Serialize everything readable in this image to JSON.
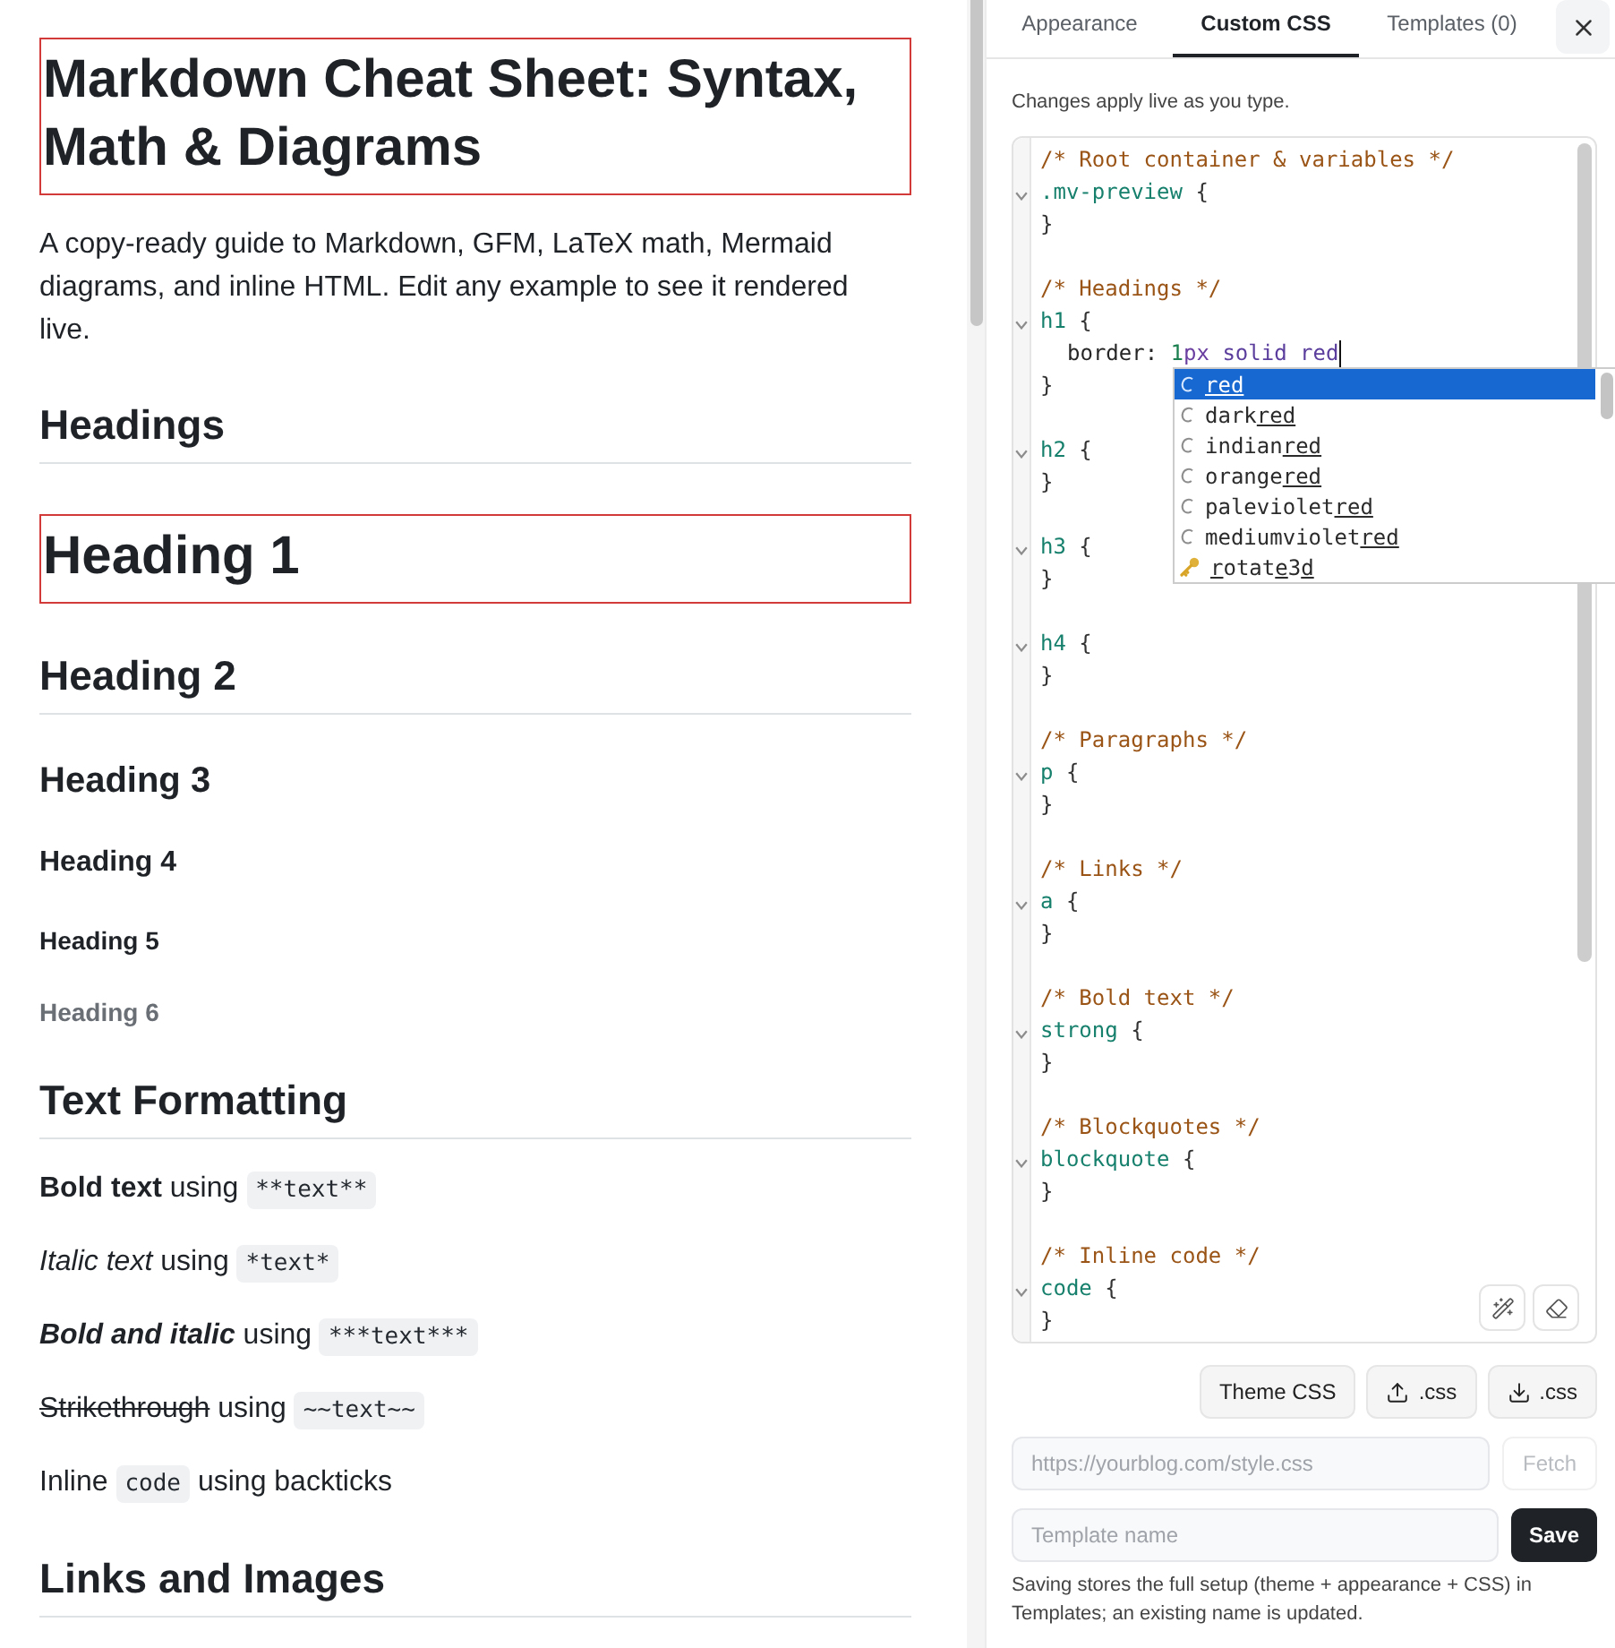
{
  "preview": {
    "blocks": [
      {
        "kind": "h1",
        "text": "Markdown Cheat Sheet: Syntax, Math & Diagrams"
      },
      {
        "kind": "p",
        "text": "A copy-ready guide to Markdown, GFM, LaTeX math, Mermaid diagrams, and inline HTML. Edit any example to see it rendered live."
      },
      {
        "kind": "h2",
        "text": "Headings"
      },
      {
        "kind": "h1",
        "text": "Heading 1"
      },
      {
        "kind": "h2",
        "text": "Heading 2"
      },
      {
        "kind": "h3",
        "text": "Heading 3"
      },
      {
        "kind": "h4",
        "text": "Heading 4"
      },
      {
        "kind": "h5",
        "text": "Heading 5"
      },
      {
        "kind": "h6",
        "text": "Heading 6"
      },
      {
        "kind": "h2",
        "text": "Text Formatting"
      },
      {
        "kind": "p",
        "parts": [
          {
            "kind": "bold",
            "text": "Bold text"
          },
          {
            "kind": "plain",
            "text": " using "
          },
          {
            "kind": "code",
            "text": "**text**"
          }
        ]
      },
      {
        "kind": "p",
        "parts": [
          {
            "kind": "italic",
            "text": "Italic text"
          },
          {
            "kind": "plain",
            "text": " using "
          },
          {
            "kind": "code",
            "text": "*text*"
          }
        ]
      },
      {
        "kind": "p",
        "parts": [
          {
            "kind": "bold-italic",
            "text": "Bold and italic"
          },
          {
            "kind": "plain",
            "text": " using "
          },
          {
            "kind": "code",
            "text": "***text***"
          }
        ]
      },
      {
        "kind": "p",
        "parts": [
          {
            "kind": "strike",
            "text": "Strikethrough"
          },
          {
            "kind": "plain",
            "text": " using "
          },
          {
            "kind": "code",
            "text": "~~text~~"
          }
        ]
      },
      {
        "kind": "p",
        "parts": [
          {
            "kind": "plain",
            "text": "Inline "
          },
          {
            "kind": "code",
            "text": "code"
          },
          {
            "kind": "plain",
            "text": " using backticks"
          }
        ]
      },
      {
        "kind": "h2",
        "text": "Links and Images"
      }
    ]
  },
  "panel": {
    "tabs": [
      {
        "label": "Appearance",
        "selected": false
      },
      {
        "label": "Custom CSS",
        "selected": true
      },
      {
        "label": "Templates (0)",
        "selected": false
      }
    ],
    "hint": "Changes apply live as you type.",
    "editor": {
      "blocks": [
        {
          "lines": [
            {
              "foldable": false,
              "tokens": [
                {
                  "kind": "comment",
                  "text": "/* Root container & variables */"
                }
              ]
            },
            {
              "foldable": true,
              "tokens": [
                {
                  "kind": "selector",
                  "text": ".mv-preview"
                },
                {
                  "kind": "punct",
                  "text": " {"
                }
              ]
            },
            {
              "foldable": false,
              "tokens": [
                {
                  "kind": "punct",
                  "text": "}"
                }
              ]
            }
          ]
        },
        {
          "lines": [
            {
              "foldable": false,
              "tokens": [
                {
                  "kind": "comment",
                  "text": "/* Headings */"
                }
              ]
            },
            {
              "foldable": true,
              "tokens": [
                {
                  "kind": "selector",
                  "text": "h1"
                },
                {
                  "kind": "punct",
                  "text": " {"
                }
              ]
            },
            {
              "foldable": false,
              "indented": true,
              "cursor": true,
              "tokens": [
                {
                  "kind": "property",
                  "text": "border:"
                },
                {
                  "kind": "number",
                  "text": " 1"
                },
                {
                  "kind": "unit",
                  "text": "px"
                },
                {
                  "kind": "keyword",
                  "text": " solid red"
                }
              ]
            },
            {
              "foldable": false,
              "tokens": [
                {
                  "kind": "punct",
                  "text": "}"
                }
              ]
            }
          ]
        },
        {
          "lines": [
            {
              "foldable": true,
              "tokens": [
                {
                  "kind": "selector",
                  "text": "h2"
                },
                {
                  "kind": "punct",
                  "text": " {"
                }
              ]
            },
            {
              "foldable": false,
              "tokens": [
                {
                  "kind": "punct",
                  "text": "}"
                }
              ]
            }
          ]
        },
        {
          "lines": [
            {
              "foldable": true,
              "tokens": [
                {
                  "kind": "selector",
                  "text": "h3"
                },
                {
                  "kind": "punct",
                  "text": " {"
                }
              ]
            },
            {
              "foldable": false,
              "tokens": [
                {
                  "kind": "punct",
                  "text": "}"
                }
              ]
            }
          ]
        },
        {
          "lines": [
            {
              "foldable": true,
              "tokens": [
                {
                  "kind": "selector",
                  "text": "h4"
                },
                {
                  "kind": "punct",
                  "text": " {"
                }
              ]
            },
            {
              "foldable": false,
              "tokens": [
                {
                  "kind": "punct",
                  "text": "}"
                }
              ]
            }
          ]
        },
        {
          "lines": [
            {
              "foldable": false,
              "tokens": [
                {
                  "kind": "comment",
                  "text": "/* Paragraphs */"
                }
              ]
            },
            {
              "foldable": true,
              "tokens": [
                {
                  "kind": "selector",
                  "text": "p"
                },
                {
                  "kind": "punct",
                  "text": " {"
                }
              ]
            },
            {
              "foldable": false,
              "tokens": [
                {
                  "kind": "punct",
                  "text": "}"
                }
              ]
            }
          ]
        },
        {
          "lines": [
            {
              "foldable": false,
              "tokens": [
                {
                  "kind": "comment",
                  "text": "/* Links */"
                }
              ]
            },
            {
              "foldable": true,
              "tokens": [
                {
                  "kind": "selector",
                  "text": "a"
                },
                {
                  "kind": "punct",
                  "text": " {"
                }
              ]
            },
            {
              "foldable": false,
              "tokens": [
                {
                  "kind": "punct",
                  "text": "}"
                }
              ]
            }
          ]
        },
        {
          "lines": [
            {
              "foldable": false,
              "tokens": [
                {
                  "kind": "comment",
                  "text": "/* Bold text */"
                }
              ]
            },
            {
              "foldable": true,
              "tokens": [
                {
                  "kind": "selector",
                  "text": "strong"
                },
                {
                  "kind": "punct",
                  "text": " {"
                }
              ]
            },
            {
              "foldable": false,
              "tokens": [
                {
                  "kind": "punct",
                  "text": "}"
                }
              ]
            }
          ]
        },
        {
          "lines": [
            {
              "foldable": false,
              "tokens": [
                {
                  "kind": "comment",
                  "text": "/* Blockquotes */"
                }
              ]
            },
            {
              "foldable": true,
              "tokens": [
                {
                  "kind": "selector",
                  "text": "blockquote"
                },
                {
                  "kind": "punct",
                  "text": " {"
                }
              ]
            },
            {
              "foldable": false,
              "tokens": [
                {
                  "kind": "punct",
                  "text": "}"
                }
              ]
            }
          ]
        },
        {
          "lines": [
            {
              "foldable": false,
              "tokens": [
                {
                  "kind": "comment",
                  "text": "/* Inline code */"
                }
              ]
            },
            {
              "foldable": true,
              "tokens": [
                {
                  "kind": "selector",
                  "text": "code"
                },
                {
                  "kind": "punct",
                  "text": " {"
                }
              ]
            },
            {
              "foldable": false,
              "tokens": [
                {
                  "kind": "punct",
                  "text": "}"
                }
              ]
            }
          ]
        }
      ],
      "autocomplete": {
        "items": [
          {
            "kind": "constant",
            "selected": true,
            "parts": [
              {
                "text": "red",
                "matched": true
              }
            ]
          },
          {
            "kind": "constant",
            "selected": false,
            "parts": [
              {
                "text": "dark",
                "matched": false
              },
              {
                "text": "red",
                "matched": true
              }
            ]
          },
          {
            "kind": "constant",
            "selected": false,
            "parts": [
              {
                "text": "indian",
                "matched": false
              },
              {
                "text": "red",
                "matched": true
              }
            ]
          },
          {
            "kind": "constant",
            "selected": false,
            "parts": [
              {
                "text": "orange",
                "matched": false
              },
              {
                "text": "red",
                "matched": true
              }
            ]
          },
          {
            "kind": "constant",
            "selected": false,
            "parts": [
              {
                "text": "paleviolet",
                "matched": false
              },
              {
                "text": "red",
                "matched": true
              }
            ]
          },
          {
            "kind": "constant",
            "selected": false,
            "parts": [
              {
                "text": "mediumviolet",
                "matched": false
              },
              {
                "text": "red",
                "matched": true
              }
            ]
          },
          {
            "kind": "property",
            "selected": false,
            "parts": [
              {
                "text": "r",
                "matched": true
              },
              {
                "text": "otat",
                "matched": false
              },
              {
                "text": "e",
                "matched": true
              },
              {
                "text": "3",
                "matched": false
              },
              {
                "text": "d",
                "matched": true
              }
            ]
          }
        ]
      }
    },
    "actions": [
      {
        "kind": "plain",
        "label": "Theme CSS"
      },
      {
        "kind": "upload",
        "label": ".css"
      },
      {
        "kind": "download",
        "label": ".css"
      }
    ],
    "url_field": {
      "placeholder": "https://yourblog.com/style.css"
    },
    "fetch_button": {
      "label": "Fetch",
      "disabled": true
    },
    "template_field": {
      "placeholder": "Template name"
    },
    "save_button": {
      "label": "Save"
    },
    "note": "Saving stores the full setup (theme + appearance + CSS) in Templates; an existing name is updated."
  }
}
